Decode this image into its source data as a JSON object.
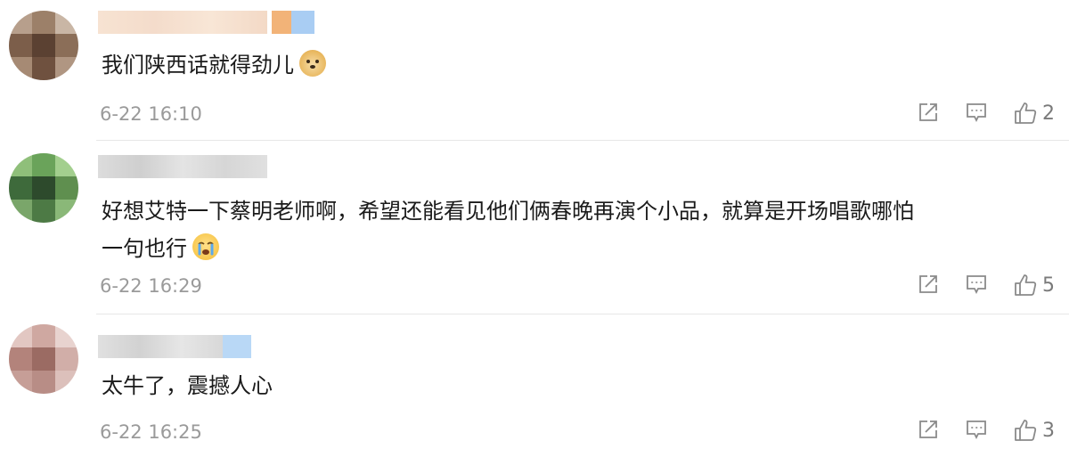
{
  "comments": [
    {
      "username": "",
      "text": "我们陕西话就得劲儿",
      "emoji": "doge-emoji",
      "time": "6-22 16:10",
      "likes": "2"
    },
    {
      "username": "",
      "text_line1": "好想艾特一下蔡明老师啊，希望还能看见他们俩春晚再演个小品，就算是开场唱歌哪怕",
      "text_line2": "一句也行",
      "emoji": "crying-emoji",
      "time": "6-22 16:29",
      "likes": "5"
    },
    {
      "username": "",
      "text": "太牛了，震撼人心",
      "time": "6-22 16:25",
      "likes": "3"
    }
  ],
  "colors": {
    "text": "#1a1a1a",
    "meta": "#9a9a9a",
    "icon": "#8a8a8a",
    "divider": "#e6e6e6"
  }
}
